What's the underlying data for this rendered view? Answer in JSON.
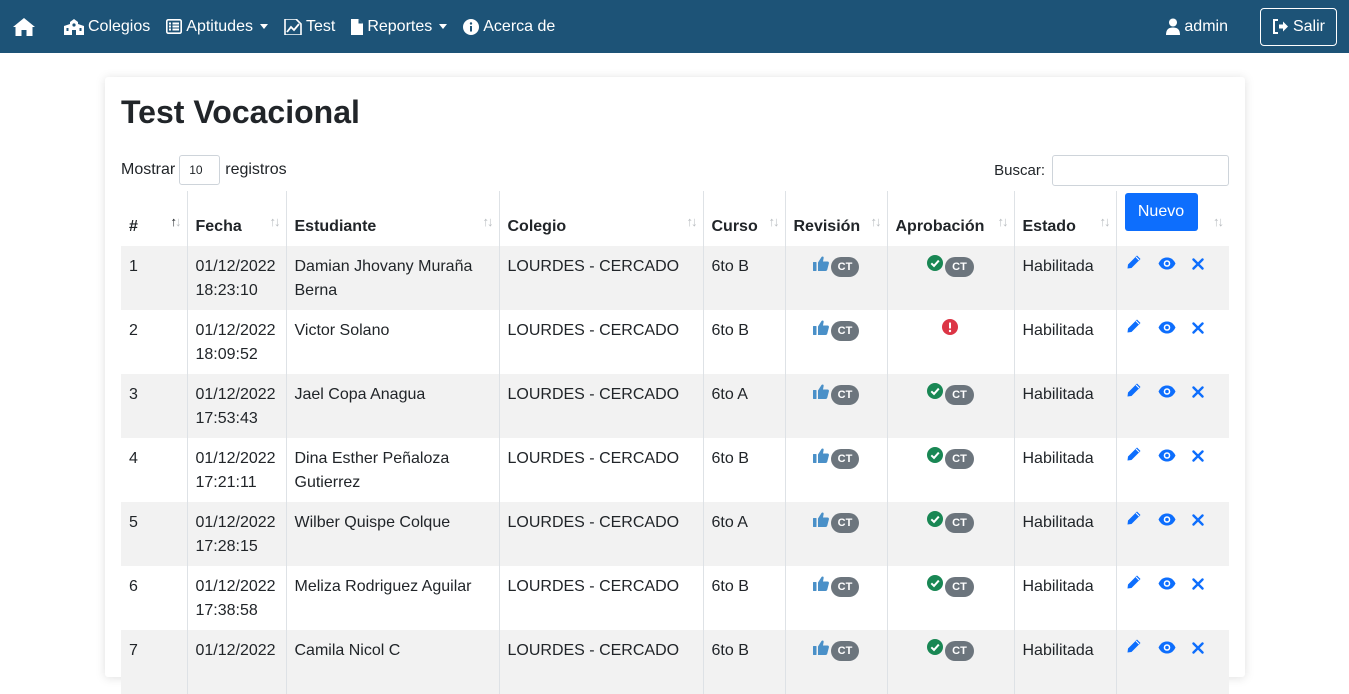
{
  "nav": {
    "home_icon": "home-icon",
    "items": [
      {
        "label": "Colegios",
        "icon": "school-icon",
        "dropdown": false
      },
      {
        "label": "Aptitudes",
        "icon": "list-icon",
        "dropdown": true
      },
      {
        "label": "Test",
        "icon": "chart-doc-icon",
        "dropdown": false
      },
      {
        "label": "Reportes",
        "icon": "file-icon",
        "dropdown": true
      },
      {
        "label": "Acerca de",
        "icon": "info-icon",
        "dropdown": false
      }
    ],
    "user_label": "admin",
    "logout_label": "Salir"
  },
  "page": {
    "title": "Test Vocacional",
    "length_prefix": "Mostrar",
    "length_value": "10",
    "length_suffix": "registros",
    "search_label": "Buscar:",
    "search_value": ""
  },
  "table": {
    "columns": [
      "#",
      "Fecha",
      "Estudiante",
      "Colegio",
      "Curso",
      "Revisión",
      "Aprobación",
      "Estado"
    ],
    "new_button": "Nuevo",
    "badge": "CT",
    "rows": [
      {
        "n": "1",
        "fecha": "01/12/2022",
        "hora": "18:23:10",
        "estudiante": "Damian Jhovany Muraña Berna",
        "colegio": "LOURDES - CERCADO",
        "curso": "6to B",
        "aprobado": true,
        "estado": "Habilitada"
      },
      {
        "n": "2",
        "fecha": "01/12/2022",
        "hora": "18:09:52",
        "estudiante": "Victor Solano",
        "colegio": "LOURDES - CERCADO",
        "curso": "6to B",
        "aprobado": false,
        "estado": "Habilitada"
      },
      {
        "n": "3",
        "fecha": "01/12/2022",
        "hora": "17:53:43",
        "estudiante": "Jael Copa Anagua",
        "colegio": "LOURDES - CERCADO",
        "curso": "6to A",
        "aprobado": true,
        "estado": "Habilitada"
      },
      {
        "n": "4",
        "fecha": "01/12/2022",
        "hora": "17:21:11",
        "estudiante": "Dina Esther Peñaloza Gutierrez",
        "colegio": "LOURDES - CERCADO",
        "curso": "6to B",
        "aprobado": true,
        "estado": "Habilitada"
      },
      {
        "n": "5",
        "fecha": "01/12/2022",
        "hora": "17:28:15",
        "estudiante": "Wilber Quispe Colque",
        "colegio": "LOURDES - CERCADO",
        "curso": "6to A",
        "aprobado": true,
        "estado": "Habilitada"
      },
      {
        "n": "6",
        "fecha": "01/12/2022",
        "hora": "17:38:58",
        "estudiante": "Meliza Rodriguez Aguilar",
        "colegio": "LOURDES - CERCADO",
        "curso": "6to B",
        "aprobado": true,
        "estado": "Habilitada"
      },
      {
        "n": "7",
        "fecha": "01/12/2022",
        "hora": "",
        "estudiante": "Camila Nicol C",
        "colegio": "LOURDES - CERCADO",
        "curso": "6to B",
        "aprobado": true,
        "estado": "Habilitada"
      }
    ]
  },
  "colors": {
    "navbar": "#1d5377",
    "primary": "#0d6efd",
    "thumb": "#4a90c8",
    "check": "#198754",
    "alert": "#dc3545",
    "badge": "#6c757d",
    "action": "#0d6efd"
  }
}
